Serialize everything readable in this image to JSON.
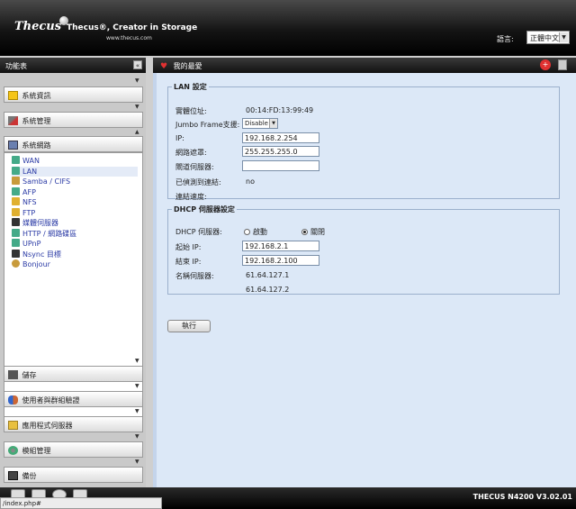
{
  "header": {
    "logo": "Thecus",
    "tagline": "Thecus®, Creator in Storage",
    "url": "www.thecus.com",
    "language_label": "語言:",
    "language_value": "正體中文"
  },
  "sidebar": {
    "title": "功能表",
    "sections": [
      {
        "label": "系統資訊",
        "icon": "info-icon"
      },
      {
        "label": "系統管理",
        "icon": "tools-icon"
      },
      {
        "label": "系統網路",
        "icon": "network-icon"
      },
      {
        "label": "儲存",
        "icon": "storage-icon"
      },
      {
        "label": "使用者與群組驗證",
        "icon": "users-icon"
      },
      {
        "label": "應用程式伺服器",
        "icon": "folder-app-icon"
      },
      {
        "label": "模組管理",
        "icon": "gear-icon"
      },
      {
        "label": "備份",
        "icon": "backup-icon"
      }
    ],
    "network_items": [
      "WAN",
      "LAN",
      "Samba / CIFS",
      "AFP",
      "NFS",
      "FTP",
      "媒體伺服器",
      "HTTP / 網路碟區",
      "UPnP",
      "Nsync 目標",
      "Bonjour"
    ],
    "selected_item": "LAN"
  },
  "main": {
    "favorite_title": "我的最愛",
    "lan": {
      "legend": "LAN 設定",
      "mac_label": "實體位址:",
      "mac_value": "00:14:FD:13:99:49",
      "jumbo_label": "Jumbo Frame支援:",
      "jumbo_value": "Disable",
      "ip_label": "IP:",
      "ip_value": "192.168.2.254",
      "netmask_label": "網路遮罩:",
      "netmask_value": "255.255.255.0",
      "gateway_label": "閘道伺服器:",
      "gateway_value": "",
      "link_label": "已偵測到連結:",
      "link_value": "no",
      "speed_label": "連結速度:"
    },
    "dhcp": {
      "legend": "DHCP 伺服器設定",
      "dhcp_label": "DHCP 伺服器:",
      "enable_label": "啟動",
      "disable_label": "關閉",
      "enabled": false,
      "start_label": "起始 IP:",
      "start_value": "192.168.2.1",
      "end_label": "結束 IP:",
      "end_value": "192.168.2.100",
      "dns_label": "名稱伺服器:",
      "dns1": "61.64.127.1",
      "dns2": "61.64.127.2"
    },
    "apply_label": "執行"
  },
  "footer": {
    "version": "THECUS N4200 V3.02.01",
    "status_url": "/index.php#"
  }
}
